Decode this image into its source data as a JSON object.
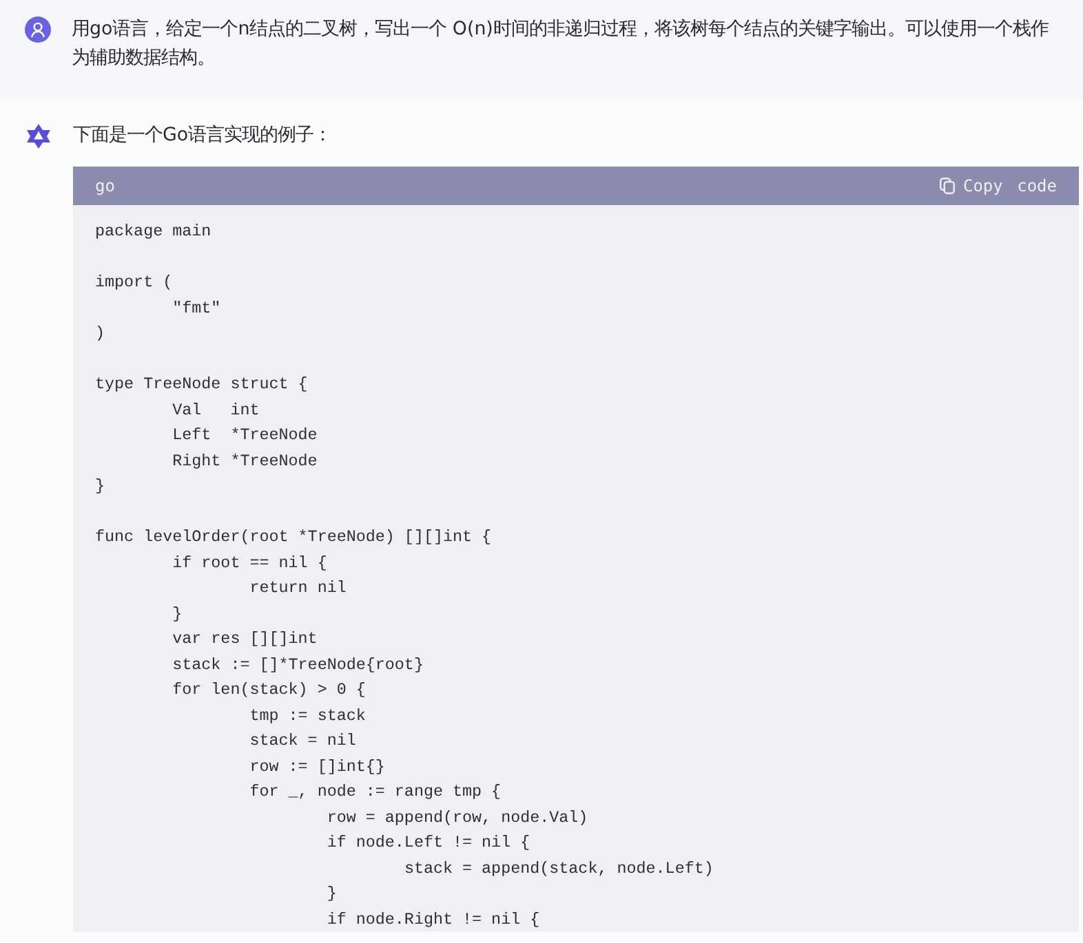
{
  "user_message": {
    "text": "用go语言，给定一个n结点的二叉树，写出一个 O(n)时间的非递归过程，将该树每个结点的关键字输出。可以使用一个栈作为辅助数据结构。"
  },
  "assistant_message": {
    "text": "下面是一个Go语言实现的例子：",
    "code_block": {
      "language": "go",
      "copy_label": "Copy code",
      "code": "package main\n\nimport (\n\t\"fmt\"\n)\n\ntype TreeNode struct {\n\tVal   int\n\tLeft  *TreeNode\n\tRight *TreeNode\n}\n\nfunc levelOrder(root *TreeNode) [][]int {\n\tif root == nil {\n\t\treturn nil\n\t}\n\tvar res [][]int\n\tstack := []*TreeNode{root}\n\tfor len(stack) > 0 {\n\t\ttmp := stack\n\t\tstack = nil\n\t\trow := []int{}\n\t\tfor _, node := range tmp {\n\t\t\trow = append(row, node.Val)\n\t\t\tif node.Left != nil {\n\t\t\t\tstack = append(stack, node.Left)\n\t\t\t}\n\t\t\tif node.Right != nil {"
    }
  }
}
